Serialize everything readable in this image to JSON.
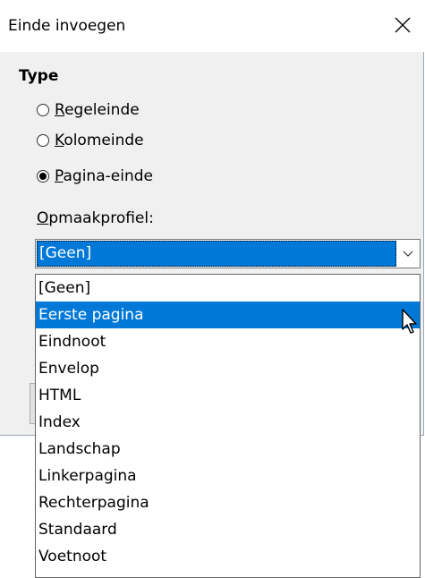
{
  "dialog": {
    "title": "Einde invoegen",
    "close_icon": "close-x-icon",
    "section_heading": "Type",
    "options": [
      {
        "label": "Regeleinde",
        "checked": false
      },
      {
        "label": "Kolomeinde",
        "checked": false
      },
      {
        "label": "Pagina-einde",
        "checked": true
      }
    ],
    "style_label": "Opmaakprofiel:",
    "style_value": "[Geen]",
    "dropdown_items": [
      "[Geen]",
      "Eerste pagina",
      "Eindnoot",
      "Envelop",
      "HTML",
      "Index",
      "Landschap",
      "Linkerpagina",
      "Rechterpagina",
      "Standaard",
      "Voetnoot"
    ],
    "highlighted_item": "Eerste pagina"
  },
  "colors": {
    "selection": "#0078d7",
    "dialog_bg": "#f0f0f0"
  }
}
